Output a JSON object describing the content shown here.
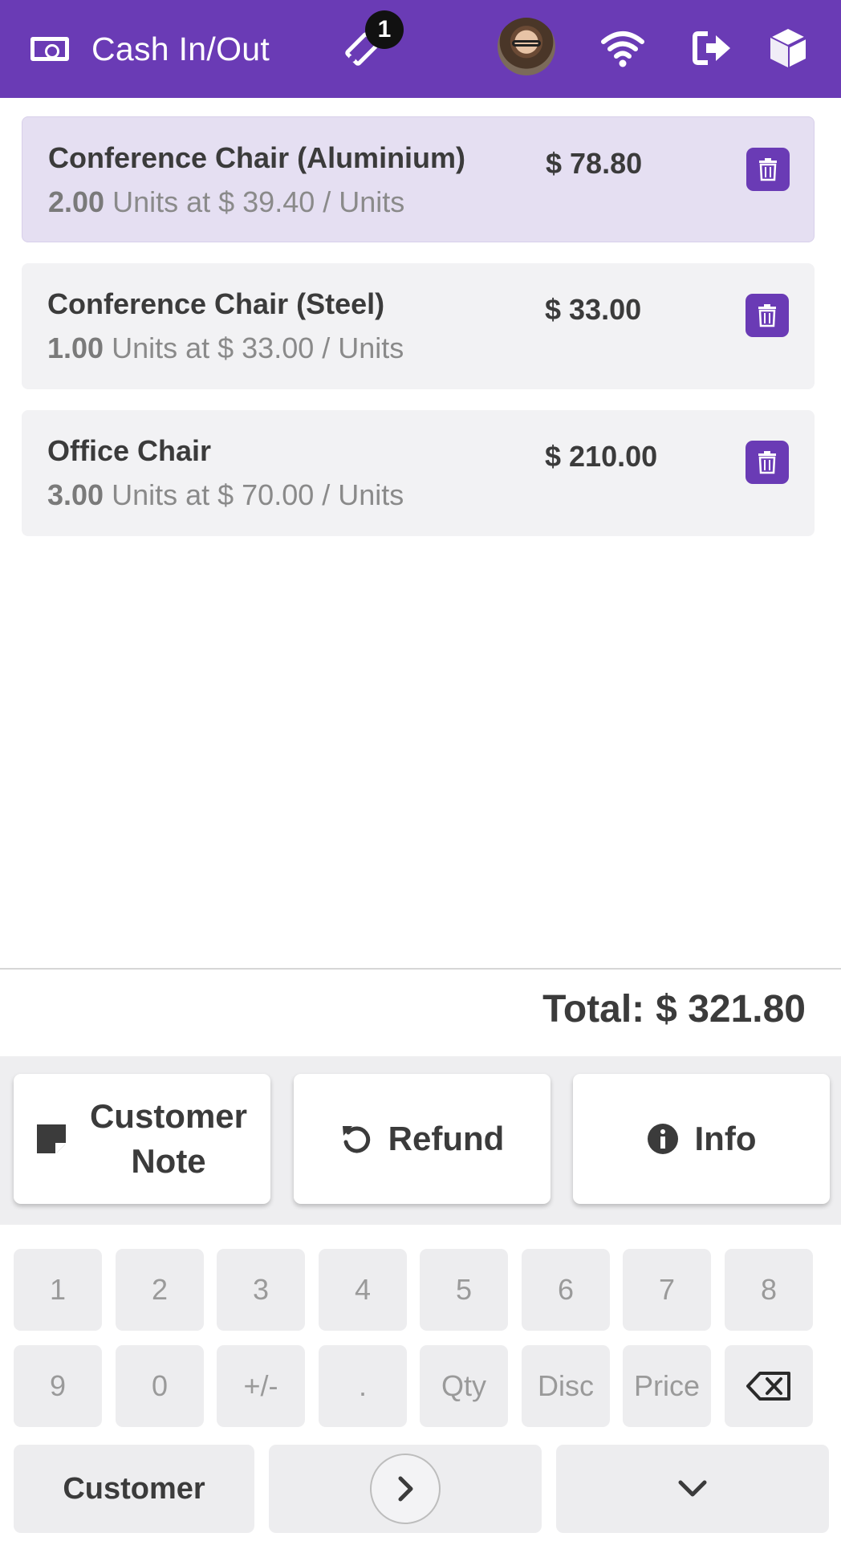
{
  "header": {
    "title": "Cash In/Out",
    "ticket_badge": "1",
    "icons": [
      "money-icon",
      "ticket-icon",
      "avatar",
      "wifi-icon",
      "sign-out-icon",
      "cube-icon"
    ],
    "accent_color": "#6a3bb5"
  },
  "order_lines": [
    {
      "name": "Conference Chair (Aluminium)",
      "qty": "2.00",
      "unit_text": "Units at $ 39.40 / Units",
      "price": "$ 78.80",
      "selected": true
    },
    {
      "name": "Conference Chair (Steel)",
      "qty": "1.00",
      "unit_text": "Units at $ 33.00 / Units",
      "price": "$ 33.00",
      "selected": false
    },
    {
      "name": "Office Chair",
      "qty": "3.00",
      "unit_text": "Units at $ 70.00 / Units",
      "price": "$ 210.00",
      "selected": false
    }
  ],
  "total": {
    "label": "Total:",
    "value": "$ 321.80"
  },
  "controls": {
    "customer_note": "Customer Note",
    "refund": "Refund",
    "info": "Info"
  },
  "numpad": {
    "row1": [
      "1",
      "2",
      "3",
      "4",
      "5",
      "6",
      "7",
      "8"
    ],
    "row2": [
      "9",
      "0",
      "+/-",
      ".",
      "Qty",
      "Disc",
      "Price"
    ],
    "customer": "Customer"
  }
}
